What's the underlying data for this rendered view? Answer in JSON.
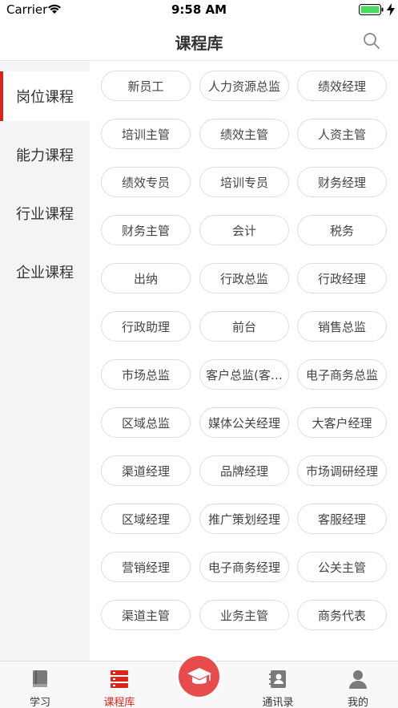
{
  "status_bar": {
    "carrier": "Carrier",
    "time": "9:58 AM"
  },
  "nav": {
    "title": "课程库"
  },
  "sidebar": {
    "items": [
      {
        "label": "岗位课程",
        "active": true
      },
      {
        "label": "能力课程",
        "active": false
      },
      {
        "label": "行业课程",
        "active": false
      },
      {
        "label": "企业课程",
        "active": false
      }
    ]
  },
  "courses": [
    "新员工",
    "人力资源总监",
    "绩效经理",
    "培训主管",
    "绩效主管",
    "人资主管",
    "绩效专员",
    "培训专员",
    "财务经理",
    "财务主管",
    "会计",
    "税务",
    "出纳",
    "行政总监",
    "行政经理",
    "行政助理",
    "前台",
    "销售总监",
    "市场总监",
    "客户总监(客…",
    "电子商务总监",
    "区域总监",
    "媒体公关经理",
    "大客户经理",
    "渠道经理",
    "品牌经理",
    "市场调研经理",
    "区域经理",
    "推广策划经理",
    "客服经理",
    "营销经理",
    "电子商务经理",
    "公关主管",
    "渠道主管",
    "业务主管",
    "商务代表"
  ],
  "tabs": [
    {
      "label": "学习",
      "icon": "book-icon",
      "active": false
    },
    {
      "label": "课程库",
      "icon": "course-library-icon",
      "active": true
    },
    {
      "label": "",
      "icon": "graduation-cap-icon",
      "active": false
    },
    {
      "label": "通讯录",
      "icon": "contacts-icon",
      "active": false
    },
    {
      "label": "我的",
      "icon": "person-icon",
      "active": false
    }
  ],
  "colors": {
    "accent": "#d9261c",
    "center_button": "#e84b4b",
    "sidebar_bg": "#f4f4f6"
  }
}
